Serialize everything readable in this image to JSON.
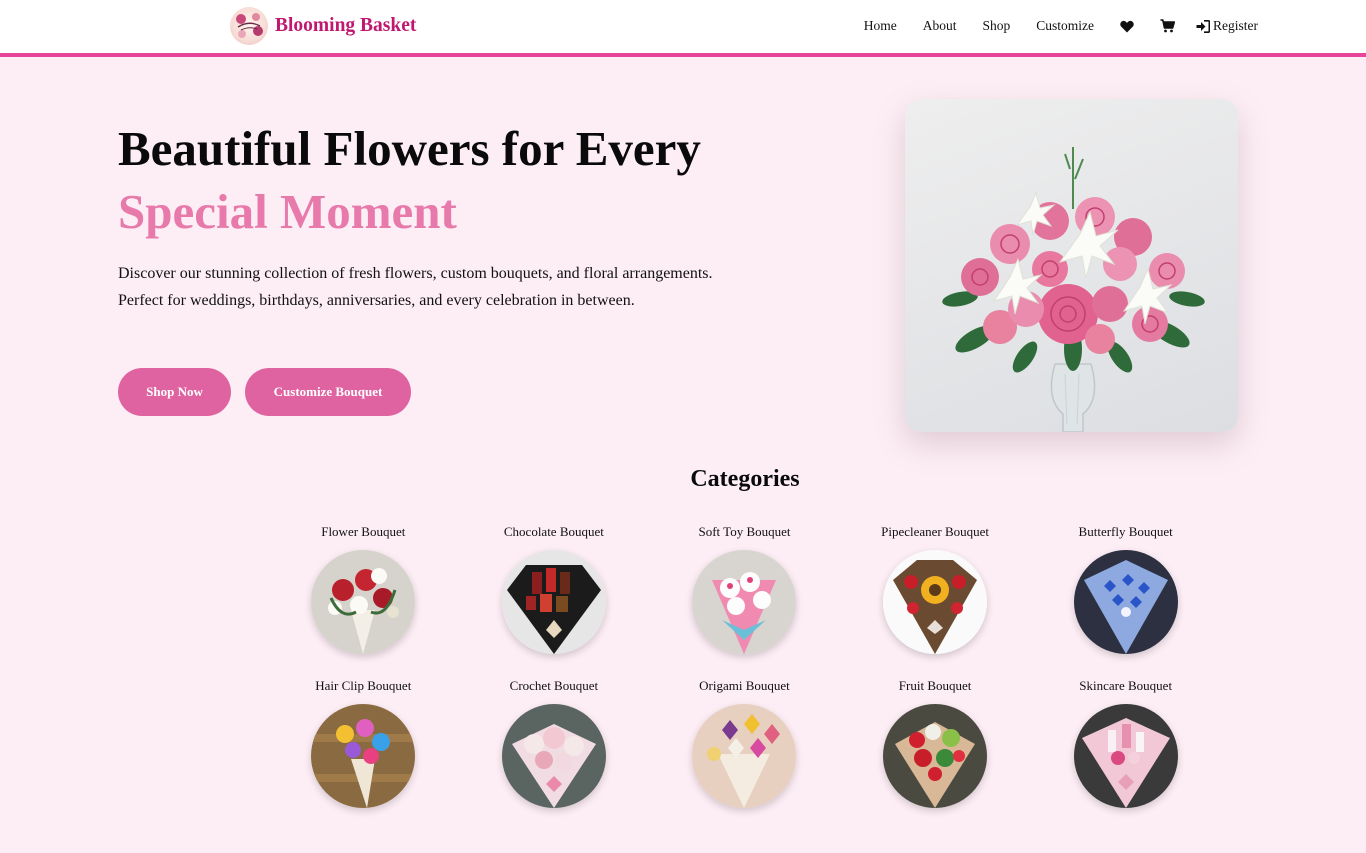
{
  "nav": {
    "brand_name": "Blooming Basket",
    "links": [
      "Home",
      "About",
      "Shop",
      "Customize"
    ],
    "wishlist_icon": "heart-icon",
    "cart_icon": "cart-icon",
    "register_icon": "sign-in-icon",
    "register_label": "Register",
    "accent_color": "#e6459a"
  },
  "hero": {
    "title_line1": "Beautiful Flowers for Every",
    "title_line2": "Special Moment",
    "description": "Discover our stunning collection of fresh flowers, custom bouquets, and floral arrangements. Perfect for weddings, birthdays, anniversaries, and every celebration in between.",
    "shop_button": "Shop Now",
    "customize_button": "Customize Bouquet"
  },
  "categories": {
    "heading": "Categories",
    "items": [
      {
        "label": "Flower Bouquet"
      },
      {
        "label": "Chocolate Bouquet"
      },
      {
        "label": "Soft Toy Bouquet"
      },
      {
        "label": "Pipecleaner Bouquet"
      },
      {
        "label": "Butterfly Bouquet"
      },
      {
        "label": "Hair Clip Bouquet"
      },
      {
        "label": "Crochet Bouquet"
      },
      {
        "label": "Origami Bouquet"
      },
      {
        "label": "Fruit Bouquet"
      },
      {
        "label": "Skincare Bouquet"
      }
    ]
  },
  "colors": {
    "page_background": "#fdeef5",
    "brand_text": "#c0186f",
    "title_accent": "#e87aab",
    "button": "#e063a1"
  }
}
